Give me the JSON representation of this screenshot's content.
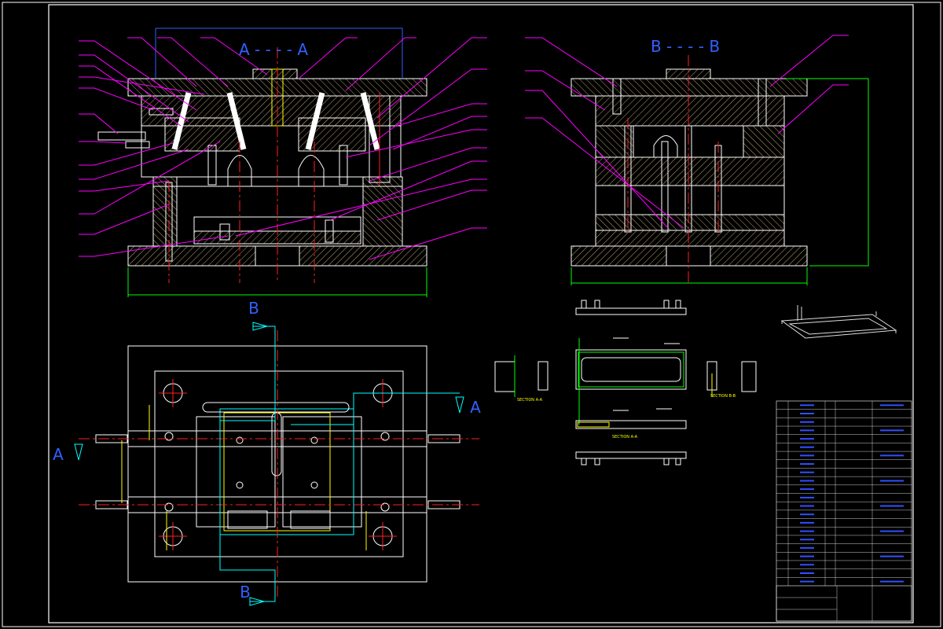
{
  "colors": {
    "background": "#000000",
    "frame": "#ffffff",
    "outline": "#ffffff",
    "hatch": "#d6c28a",
    "leader": "#ff00ff",
    "centerline": "#ff2020",
    "dimension": "#00ff00",
    "section_mark": "#3060ff",
    "cut_line": "#00ffff",
    "highlight": "#ffff00",
    "title_block_text": "#3050ff"
  },
  "views": {
    "section_a": {
      "label": "A - - - - A"
    },
    "section_b": {
      "label": "B - - - - B"
    },
    "plan": {
      "marker_b_top": "B",
      "marker_b_bottom": "B",
      "marker_a_left": "A",
      "marker_a_right": "A"
    },
    "part_views": {
      "section_a_a": "SECTION A-A",
      "section_b_b": "SECTION B-B",
      "section_c": "SECTION A-A"
    }
  },
  "title_block": {
    "rows": 22
  }
}
